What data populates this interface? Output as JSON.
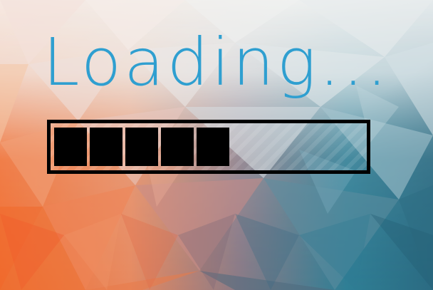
{
  "loader": {
    "title": "Loading...",
    "progress_fraction": 0.53,
    "filled_segments": 5,
    "colors": {
      "title": "#2f9fd0",
      "bar": "#000000"
    }
  }
}
